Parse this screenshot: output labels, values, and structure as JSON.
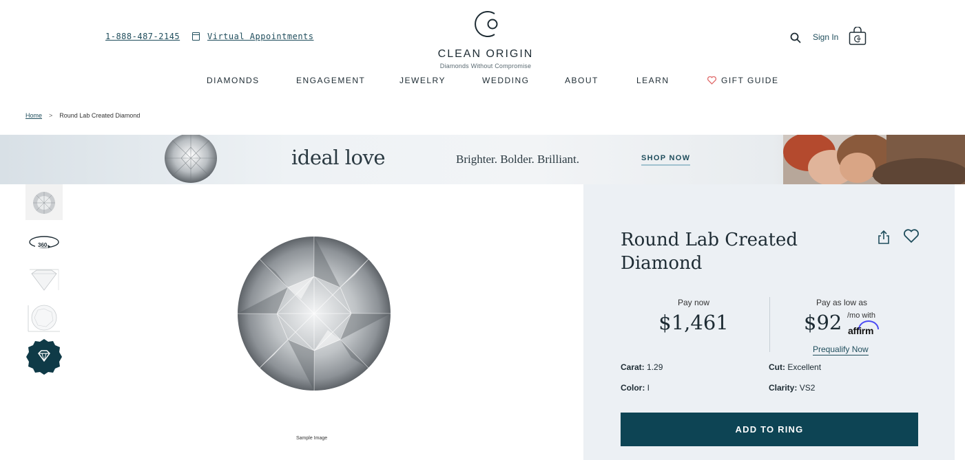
{
  "header": {
    "phone": "1-888-487-2145",
    "appointments": "Virtual Appointments",
    "logo_name": "CLEAN ORIGIN",
    "logo_tagline": "Diamonds Without Compromise",
    "sign_in": "Sign In",
    "icons": [
      "calendar-icon",
      "search-icon",
      "shopping-bag-icon"
    ]
  },
  "nav": {
    "items": [
      "DIAMONDS",
      "ENGAGEMENT",
      "JEWELRY",
      "WEDDING",
      "ABOUT",
      "LEARN",
      "GIFT GUIDE"
    ]
  },
  "breadcrumb": {
    "home": "Home",
    "separator": ">",
    "current": "Round Lab Created Diamond"
  },
  "banner": {
    "brand": "ideal love",
    "tagline": "Brighter. Bolder. Brilliant.",
    "cta": "SHOP NOW"
  },
  "gallery": {
    "thumbnails": [
      "photo",
      "360",
      "side-profile",
      "top-diagram",
      "certificate-badge"
    ],
    "thumb_360_label": "360",
    "sample_caption": "Sample Image"
  },
  "product": {
    "title": "Round Lab Created Diamond",
    "pay_now_label": "Pay now",
    "price": "$1,461",
    "pay_low_label": "Pay as low as",
    "monthly_price": "$92",
    "monthly_suffix": "/mo with",
    "affirm": "affirm",
    "prequalify": "Prequalify Now",
    "specs": {
      "carat_label": "Carat:",
      "carat": "1.29",
      "cut_label": "Cut:",
      "cut": "Excellent",
      "color_label": "Color:",
      "color": "I",
      "clarity_label": "Clarity:",
      "clarity": "VS2"
    },
    "add_button": "ADD TO RING"
  },
  "colors": {
    "primary": "#0d4454",
    "panel_bg": "#ecf0f4",
    "link": "#1f4d5c",
    "heart_accent": "#e06a6a"
  }
}
